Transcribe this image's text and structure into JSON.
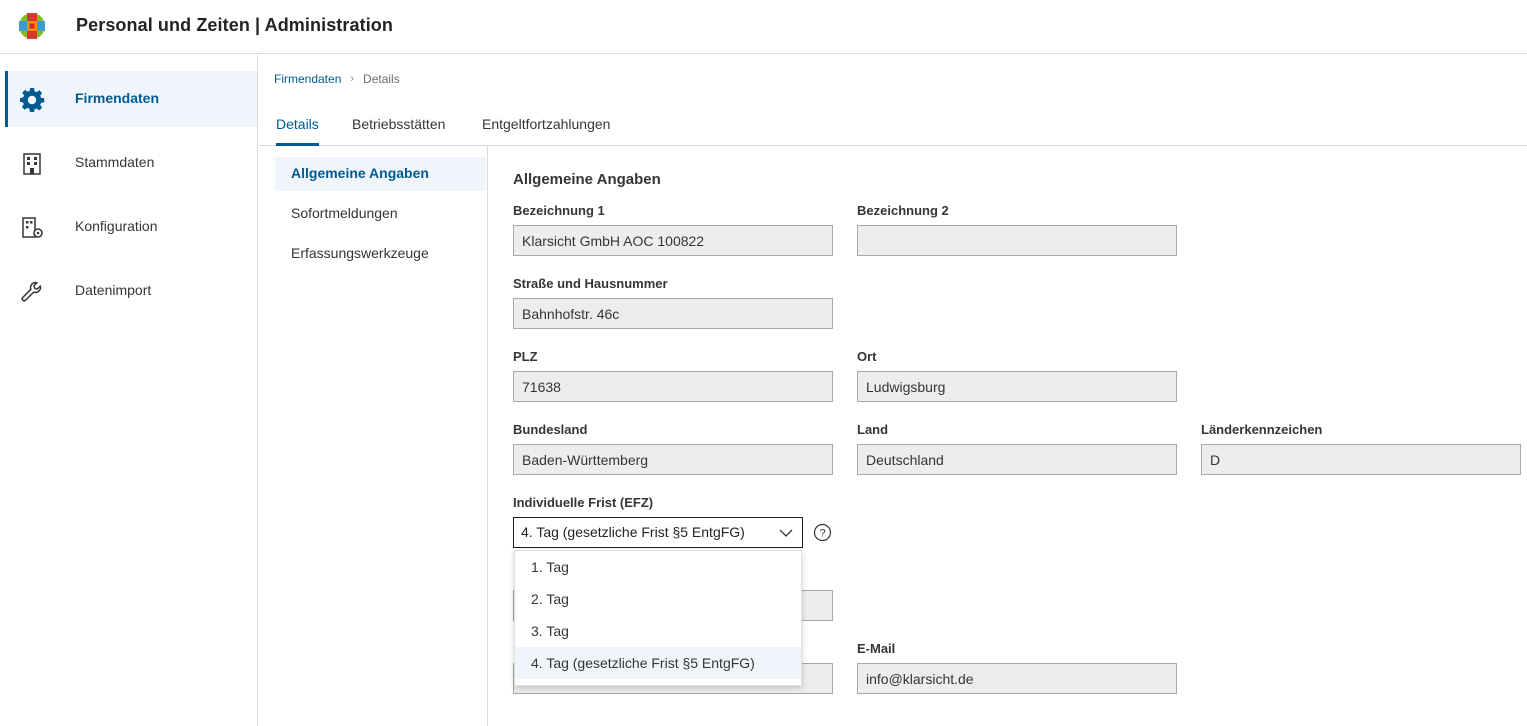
{
  "app": {
    "title": "Personal und Zeiten | Administration"
  },
  "colors": {
    "accent": "#005b92",
    "active_bg": "#eff5fa",
    "field_bg": "#ededed"
  },
  "sidebar": {
    "items": [
      {
        "label": "Firmendaten",
        "icon": "gear-icon",
        "active": true
      },
      {
        "label": "Stammdaten",
        "icon": "building-icon",
        "active": false
      },
      {
        "label": "Konfiguration",
        "icon": "building-gear-icon",
        "active": false
      },
      {
        "label": "Datenimport",
        "icon": "wrench-icon",
        "active": false
      }
    ]
  },
  "breadcrumb": {
    "root": "Firmendaten",
    "current": "Details"
  },
  "tabs": [
    {
      "label": "Details",
      "active": true
    },
    {
      "label": "Betriebsstätten",
      "active": false
    },
    {
      "label": "Entgeltfortzahlungen",
      "active": false
    }
  ],
  "subnav": [
    {
      "label": "Allgemeine Angaben",
      "active": true
    },
    {
      "label": "Sofortmeldungen",
      "active": false
    },
    {
      "label": "Erfassungswerkzeuge",
      "active": false
    }
  ],
  "form": {
    "section_title": "Allgemeine Angaben",
    "bezeichnung1": {
      "label": "Bezeichnung 1",
      "value": "Klarsicht GmbH AOC 100822"
    },
    "bezeichnung2": {
      "label": "Bezeichnung 2",
      "value": ""
    },
    "strasse": {
      "label": "Straße und Hausnummer",
      "value": "Bahnhofstr. 46c"
    },
    "plz": {
      "label": "PLZ",
      "value": "71638"
    },
    "ort": {
      "label": "Ort",
      "value": "Ludwigsburg"
    },
    "bundesland": {
      "label": "Bundesland",
      "value": "Baden-Württemberg"
    },
    "land": {
      "label": "Land",
      "value": "Deutschland"
    },
    "laenderkennzeichen": {
      "label": "Länderkennzeichen",
      "value": "D"
    },
    "frist": {
      "label": "Individuelle Frist (EFZ)",
      "value": "4. Tag (gesetzliche Frist §5 EntgFG)",
      "options": [
        "1. Tag",
        "2. Tag",
        "3. Tag",
        "4. Tag (gesetzliche Frist §5 EntgFG)"
      ],
      "selected_index": 3
    },
    "email": {
      "label": "E-Mail",
      "value": "info@klarsicht.de"
    }
  }
}
